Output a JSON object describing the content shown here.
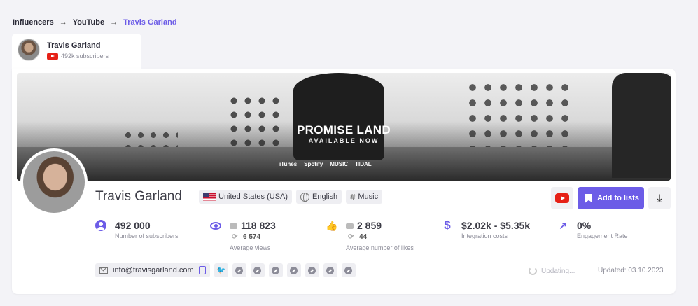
{
  "breadcrumb": {
    "items": [
      "Influencers",
      "YouTube",
      "Travis Garland"
    ],
    "separator": "→"
  },
  "tab": {
    "name": "Travis Garland",
    "subscribers": "492k subscribers"
  },
  "banner": {
    "title": "PROMISE LAND",
    "subtitle": "AVAILABLE NOW",
    "stores": [
      "iTunes",
      "Spotify",
      "MUSIC",
      "TIDAL"
    ]
  },
  "profile": {
    "name": "Travis Garland",
    "tags": {
      "country": "United States (USA)",
      "language": "English",
      "category": "Music"
    }
  },
  "actions": {
    "add_to_lists": "Add to lists"
  },
  "stats": {
    "subscribers": {
      "value": "492 000",
      "label": "Number of subscribers"
    },
    "views": {
      "value": "118 823",
      "sub": "6 574",
      "label": "Average views"
    },
    "likes": {
      "value": "2 859",
      "sub": "44",
      "label": "Average number of likes"
    },
    "cost": {
      "value": "$2.02k - $5.35k",
      "label": "Integration costs"
    },
    "engagement": {
      "value": "0%",
      "label": "Engagement Rate"
    }
  },
  "contact": {
    "email": "info@travisgarland.com"
  },
  "status": {
    "updating": "Updating...",
    "updated": "Updated: 03.10.2023"
  },
  "colors": {
    "accent": "#6c5ce7",
    "youtube": "#e62117",
    "background": "#f3f3f7"
  },
  "icons": [
    "youtube-icon",
    "bookmark-icon",
    "download-icon",
    "person-icon",
    "eye-icon",
    "thumbs-up-icon",
    "dollar-icon",
    "trend-up-icon",
    "mail-icon",
    "copy-icon",
    "twitter-icon",
    "link-icon",
    "spinner-icon"
  ]
}
